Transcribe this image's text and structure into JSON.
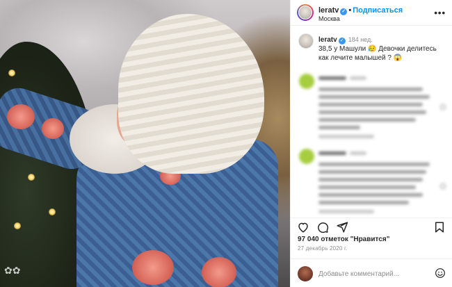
{
  "post": {
    "username": "leratv",
    "follow_label": "Подписаться",
    "separator": "•",
    "location": "Москва",
    "more_label": "•••",
    "watermark": "✿✿"
  },
  "caption": {
    "username": "leratv",
    "time": "184 нед.",
    "text": "38,5 у Машули 😥 Девочки делитесь как лечите малышей ? 😱"
  },
  "actions": {
    "likes": "97 040 отметок \"Нравится\"",
    "date": "27 декабрь 2020 г."
  },
  "comment_box": {
    "placeholder": "Добавьте комментарий..."
  },
  "icons": {
    "verified": "✓",
    "like": "heart-icon",
    "comment": "comment-icon",
    "share": "share-icon",
    "save": "bookmark-icon",
    "emoji": "emoji-icon"
  },
  "colors": {
    "link": "#0095f6",
    "verified": "#3897f0",
    "muted": "#8e8e8e",
    "comment_avatar": "#a6cd3e"
  }
}
